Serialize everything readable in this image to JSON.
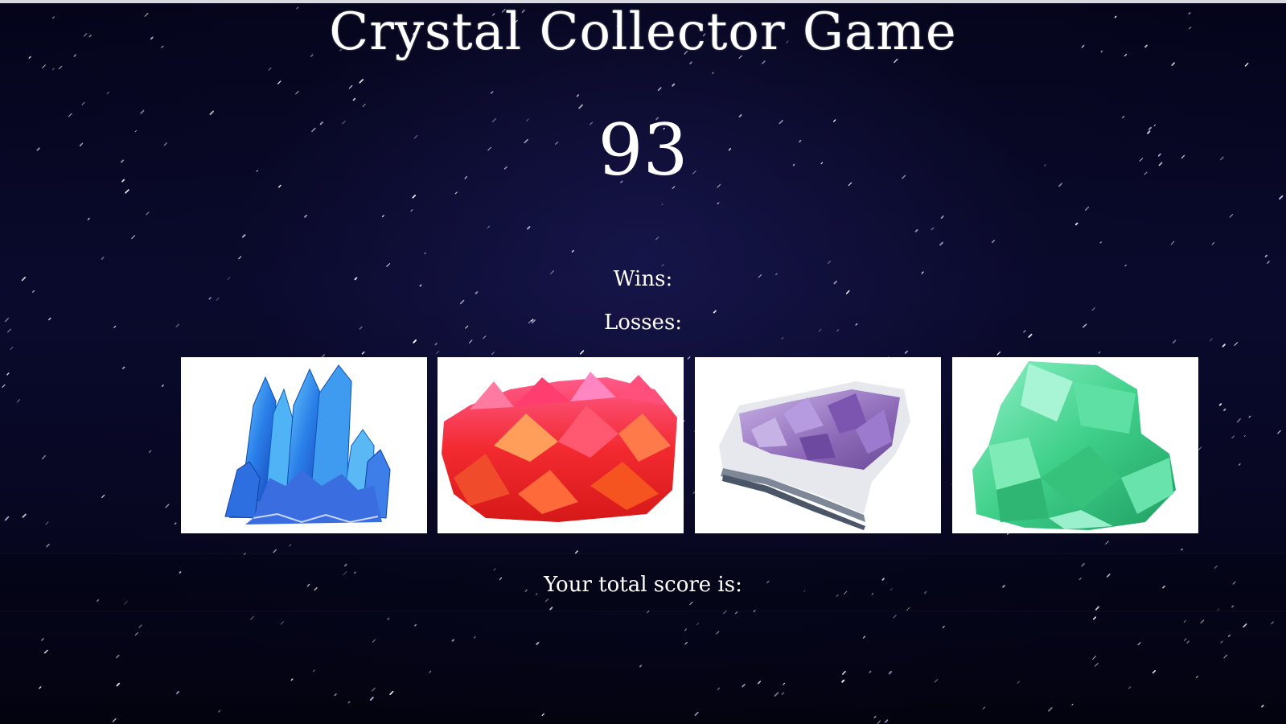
{
  "game": {
    "title": "Crystal Collector Game",
    "target_number": "93",
    "wins_label": "Wins:",
    "losses_label": "Losses:",
    "score_label": "Your total score is:"
  },
  "crystals": [
    {
      "name": "blue",
      "color": "#2b8ff0"
    },
    {
      "name": "red",
      "color": "#f23a3a"
    },
    {
      "name": "purple",
      "color": "#9a7cc8"
    },
    {
      "name": "green",
      "color": "#43d68f"
    }
  ],
  "colors": {
    "background": "#05051c",
    "text": "#ffffff"
  }
}
